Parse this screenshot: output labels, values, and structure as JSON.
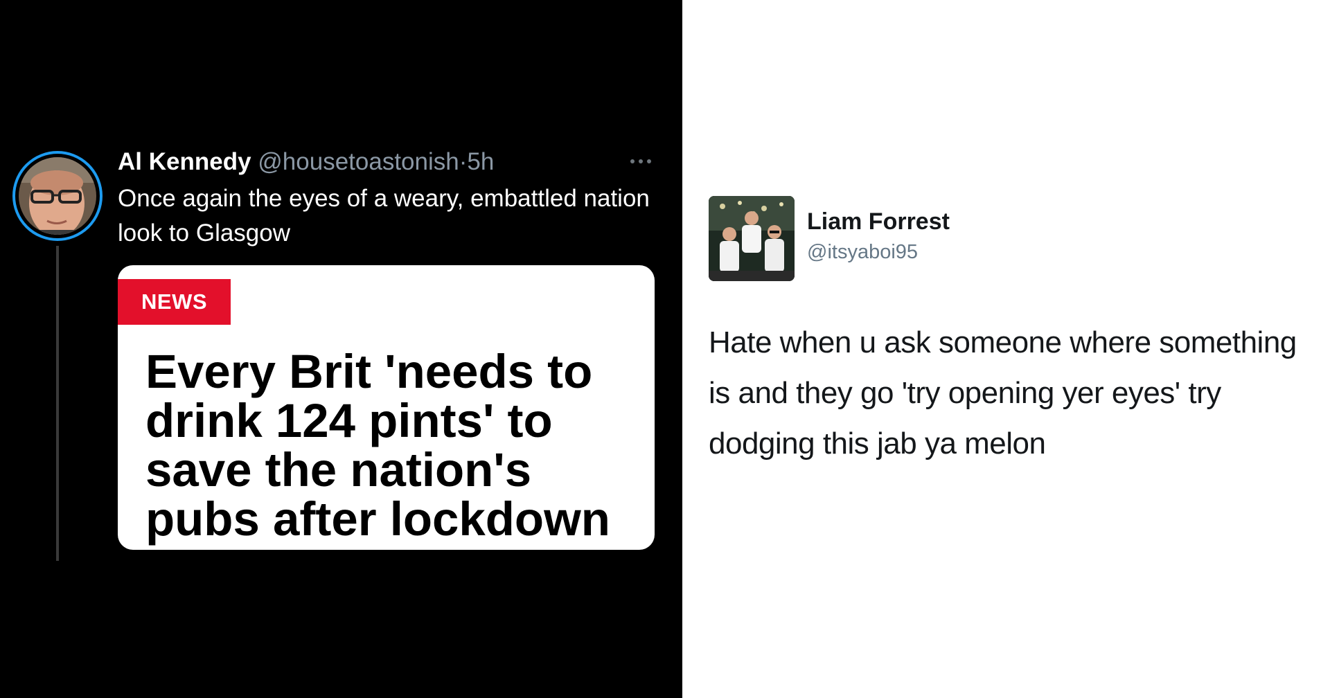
{
  "left_tweet": {
    "author_name": "Al Kennedy",
    "author_handle": "@housetoastonish",
    "separator": "·",
    "time": "5h",
    "more_icon": "more-horizontal-icon",
    "text": "Once again the eyes of a weary, embattled nation look to Glasgow",
    "card": {
      "badge": "NEWS",
      "headline": "Every Brit 'needs to drink 124 pints' to save the nation's pubs after lockdown",
      "badge_color": "#e3102b"
    },
    "avatar": "profile-photo",
    "accent_color": "#1d9bf0"
  },
  "right_tweet": {
    "author_name": "Liam Forrest",
    "author_handle": "@itsyaboi95",
    "avatar": "profile-photo",
    "text": "Hate when u ask someone where something is and they go 'try opening yer eyes' try dodging this jab ya melon"
  }
}
